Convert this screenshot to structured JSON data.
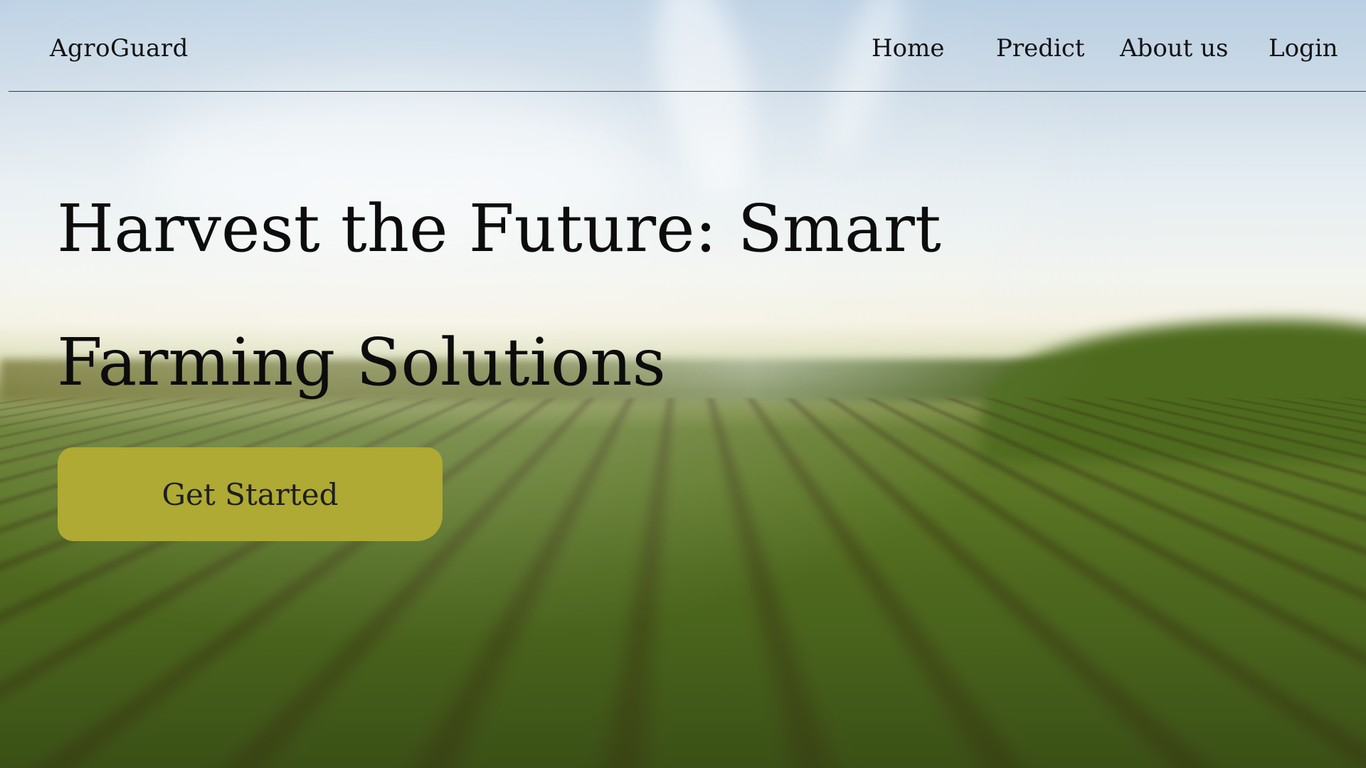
{
  "brand": {
    "name": "AgroGuard"
  },
  "nav": {
    "items": [
      {
        "label": "Home"
      },
      {
        "label": "Predict"
      },
      {
        "label": "About us"
      },
      {
        "label": "Login"
      }
    ]
  },
  "hero": {
    "headline_line1": "Harvest the Future: Smart",
    "headline_line2": "Farming Solutions",
    "cta_label": "Get Started",
    "background_image": "blurred-crop-field-at-sunrise"
  },
  "colors": {
    "cta_background": "#aeaa33",
    "text": "#111111",
    "divider": "#3a3a3a"
  }
}
